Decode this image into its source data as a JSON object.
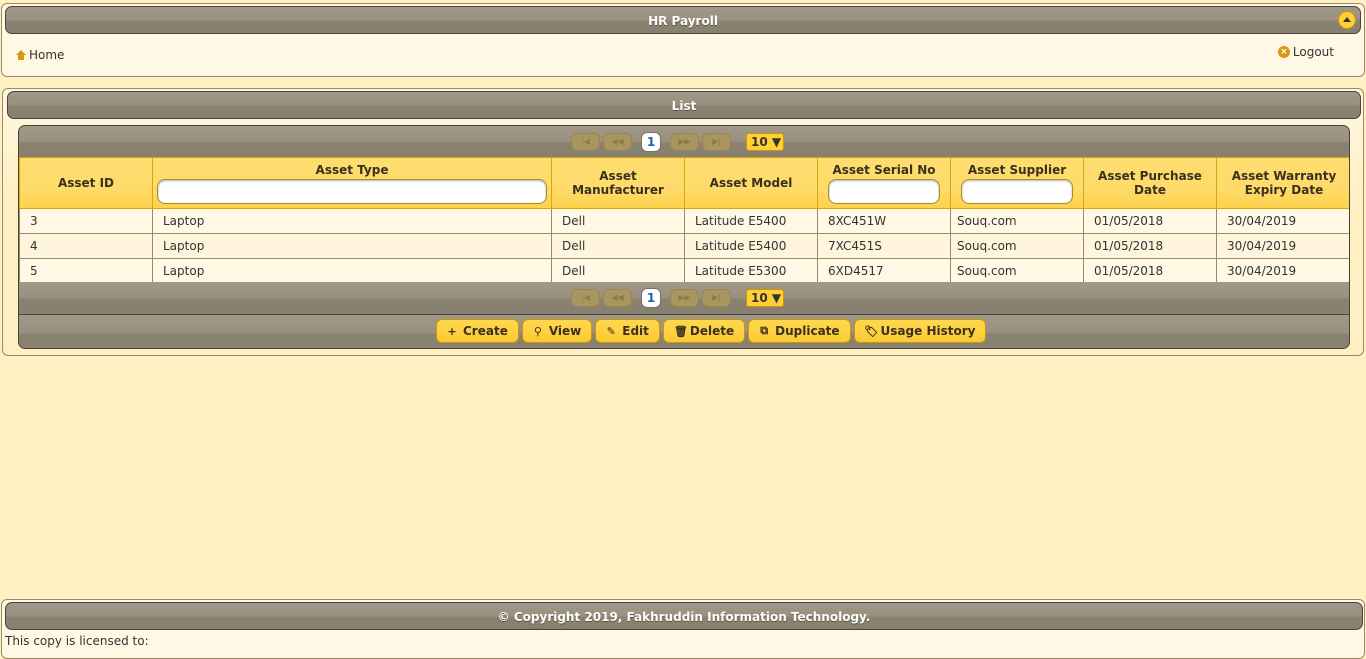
{
  "header": {
    "title": "HR Payroll",
    "collapse_icon": "chevron-up-icon",
    "home_label": "Home",
    "home_icon": "home-icon",
    "logout_label": "Logout",
    "logout_icon": "close-circle-icon"
  },
  "list": {
    "title": "List",
    "pager": {
      "first": "|◀",
      "prev": "◀◀",
      "current_page": "1",
      "next": "▶▶",
      "last": "▶|",
      "page_size": "10 ▼"
    },
    "columns": [
      {
        "label": "Asset ID",
        "filter": false
      },
      {
        "label": "Asset Type",
        "filter": true,
        "filter_value": ""
      },
      {
        "label": "Asset Manufacturer",
        "filter": false
      },
      {
        "label": "Asset Model",
        "filter": false
      },
      {
        "label": "Asset Serial No",
        "filter": true,
        "filter_value": ""
      },
      {
        "label": "Asset Supplier",
        "filter": true,
        "filter_value": ""
      },
      {
        "label": "Asset Purchase Date",
        "filter": false
      },
      {
        "label": "Asset Warranty Expiry Date",
        "filter": false
      }
    ],
    "rows": [
      [
        "3",
        "Laptop",
        "Dell",
        "Latitude E5400",
        "8XC451W",
        "Souq.com",
        "01/05/2018",
        "30/04/2019"
      ],
      [
        "4",
        "Laptop",
        "Dell",
        "Latitude E5400",
        "7XC451S",
        "Souq.com",
        "01/05/2018",
        "30/04/2019"
      ],
      [
        "5",
        "Laptop",
        "Dell",
        "Latitude E5300",
        "6XD4517",
        "Souq.com",
        "01/05/2018",
        "30/04/2019"
      ]
    ],
    "toolbar": [
      {
        "label": "Create",
        "icon": "+",
        "icon_name": "plus-icon"
      },
      {
        "label": "View",
        "icon": "⚲",
        "icon_name": "search-icon"
      },
      {
        "label": "Edit",
        "icon": "✎",
        "icon_name": "pencil-icon"
      },
      {
        "label": "Delete",
        "icon": "🗑",
        "icon_name": "trash-icon"
      },
      {
        "label": "Duplicate",
        "icon": "⧉",
        "icon_name": "copy-icon"
      },
      {
        "label": "Usage History",
        "icon": "🏷",
        "icon_name": "tag-icon"
      }
    ]
  },
  "footer": {
    "copyright": "© Copyright 2019, Fakhruddin Information Technology.",
    "license": "This copy is licensed to:"
  }
}
